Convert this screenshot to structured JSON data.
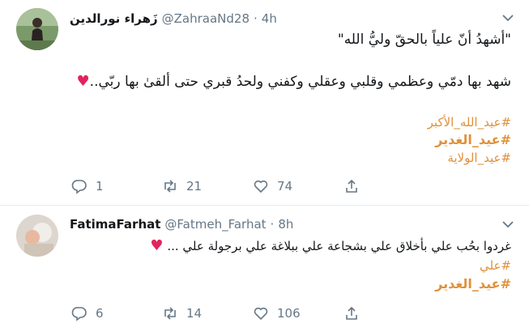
{
  "tweets": [
    {
      "display_name": "زَهراء نورالدين",
      "handle": "@ZahraaNd28",
      "separator": "·",
      "time": "4h",
      "lines": [
        "\"أشهدُ أنّ علياً بالحقّ وليُّ الله\"",
        "شهد بها دمّي وعظمي وقلبي وعقلي وكفني ولحدُ قبري حتى ألقىٰ بها ربّي.."
      ],
      "heart": "♥",
      "hashtags": [
        "#عيد_الله_الأكبر",
        "#عيد_الغدير",
        "#عيد_الولاية"
      ],
      "replies": "1",
      "retweets": "21",
      "likes": "74"
    },
    {
      "display_name": "FatimaFarhat",
      "handle": "@Fatmeh_Farhat",
      "separator": "·",
      "time": "8h",
      "lines": [
        "غردوا بحُب علي بأخلاق علي بشجاعة علي ببلاغة علي برجولة علي ..."
      ],
      "heart": "♥",
      "hashtags": [
        "#علي",
        "#عيد_الغدير"
      ],
      "replies": "6",
      "retweets": "14",
      "likes": "106"
    }
  ],
  "colors": {
    "hashtag": "#e0913b",
    "muted": "#657786",
    "heart": "#e0245e",
    "divider": "#e6ecf0"
  },
  "icons": [
    "avatar",
    "chevron-down-icon",
    "reply-icon",
    "retweet-icon",
    "like-icon",
    "share-icon"
  ]
}
